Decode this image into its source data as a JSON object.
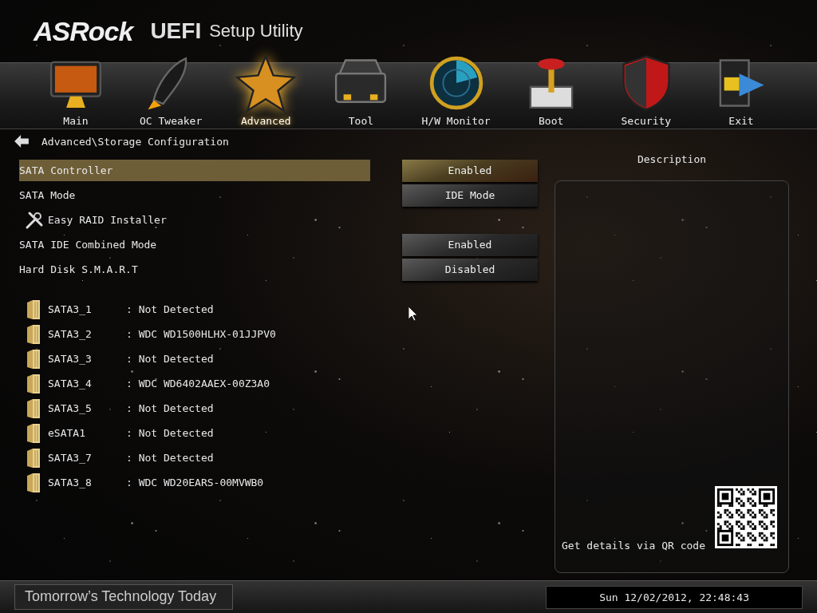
{
  "header": {
    "brand": "ASRock",
    "product": "UEFI",
    "subtitle": "Setup Utility"
  },
  "tabs": [
    {
      "label": "Main",
      "selected": false
    },
    {
      "label": "OC Tweaker",
      "selected": false
    },
    {
      "label": "Advanced",
      "selected": true
    },
    {
      "label": "Tool",
      "selected": false
    },
    {
      "label": "H/W Monitor",
      "selected": false
    },
    {
      "label": "Boot",
      "selected": false
    },
    {
      "label": "Security",
      "selected": false
    },
    {
      "label": "Exit",
      "selected": false
    }
  ],
  "breadcrumb": "Advanced\\Storage Configuration",
  "settings": [
    {
      "kind": "option",
      "label": "SATA Controller",
      "value": "Enabled",
      "selected": true
    },
    {
      "kind": "option",
      "label": "SATA Mode",
      "value": "IDE Mode",
      "selected": false
    },
    {
      "kind": "submenu",
      "label": "Easy RAID Installer",
      "selected": false
    },
    {
      "kind": "option",
      "label": "SATA IDE Combined Mode",
      "value": "Enabled",
      "selected": false
    },
    {
      "kind": "option",
      "label": "Hard Disk S.M.A.R.T",
      "value": "Disabled",
      "selected": false
    }
  ],
  "devices": [
    {
      "port": "SATA3_1",
      "value": ": Not Detected"
    },
    {
      "port": "SATA3_2",
      "value": ": WDC WD1500HLHX-01JJPV0"
    },
    {
      "port": "SATA3_3",
      "value": ": Not Detected"
    },
    {
      "port": "SATA3_4",
      "value": ": WDC WD6402AAEX-00Z3A0"
    },
    {
      "port": "SATA3_5",
      "value": ": Not Detected"
    },
    {
      "port": "eSATA1",
      "value": ": Not Detected"
    },
    {
      "port": "SATA3_7",
      "value": ": Not Detected"
    },
    {
      "port": "SATA3_8",
      "value": ": WDC WD20EARS-00MVWB0"
    }
  ],
  "description": {
    "title": "Description",
    "qr_caption": "Get details via QR code"
  },
  "footer": {
    "slogan": "Tomorrow’s Technology Today",
    "datetime": "Sun 12/02/2012, 22:48:43"
  }
}
